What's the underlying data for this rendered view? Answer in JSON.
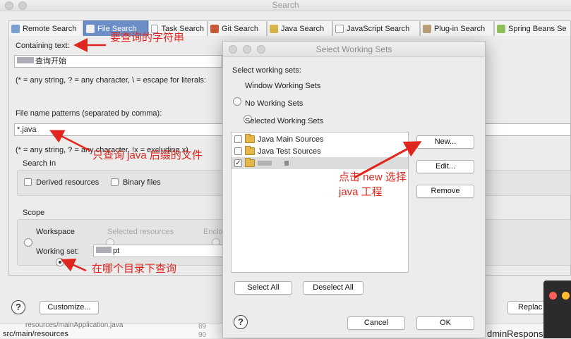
{
  "main_window": {
    "title": "Search",
    "tabs": [
      {
        "label": "Remote Search"
      },
      {
        "label": "File Search"
      },
      {
        "label": "Task Search"
      },
      {
        "label": "Git Search"
      },
      {
        "label": "Java Search"
      },
      {
        "label": "JavaScript Search"
      },
      {
        "label": "Plug-in Search"
      },
      {
        "label": "Spring Beans Se"
      }
    ],
    "containing_text_label": "Containing text:",
    "containing_text_value": "查询开始",
    "containing_hint": "(* = any string, ? = any character, \\ = escape for literals:",
    "file_patterns_label": "File name patterns (separated by comma):",
    "file_patterns_value": "*.java",
    "file_patterns_hint": "(* = any string, ? = any character, !x = excluding x)",
    "search_in": {
      "title": "Search In",
      "derived": "Derived resources",
      "binary": "Binary files"
    },
    "scope": {
      "title": "Scope",
      "workspace": "Workspace",
      "selected_resources": "Selected resources",
      "enclosing": "Enclo",
      "working_set_label": "Working set:",
      "working_set_value": "pt"
    },
    "customize_button": "Customize...",
    "replace_button": "Replac",
    "help_glyph": "?",
    "bg_tree_item": "src/main/resources",
    "bg_tree_item2": "resources/mainApplication.java",
    "bg_line_89": "89",
    "bg_line_90": "90",
    "bg_code": "dminResponse"
  },
  "dialog": {
    "title": "Select Working Sets",
    "prompt": "Select working sets:",
    "options": [
      {
        "label": "Window Working Sets",
        "selected": false
      },
      {
        "label": "No Working Sets",
        "selected": false
      },
      {
        "label": "Selected Working Sets",
        "selected": true
      }
    ],
    "list_items": [
      {
        "label": "Java Main Sources",
        "checked": false
      },
      {
        "label": "Java Test Sources",
        "checked": false
      },
      {
        "label": "",
        "checked": true
      }
    ],
    "new_button": "New...",
    "edit_button": "Edit...",
    "remove_button": "Remove",
    "select_all_button": "Select All",
    "deselect_all_button": "Deselect All",
    "cancel_button": "Cancel",
    "ok_button": "OK",
    "help_glyph": "?"
  },
  "annotations": {
    "containing_text": "要查询的字符串",
    "file_patterns": "只查询 java 后缀的文件",
    "new_button_line1": "点击 new 选择",
    "new_button_line2": "java 工程",
    "working_set": "在哪个目录下查询"
  },
  "colors": {
    "annotation": "#e0261e",
    "active_tab": "#6b8ec7"
  }
}
